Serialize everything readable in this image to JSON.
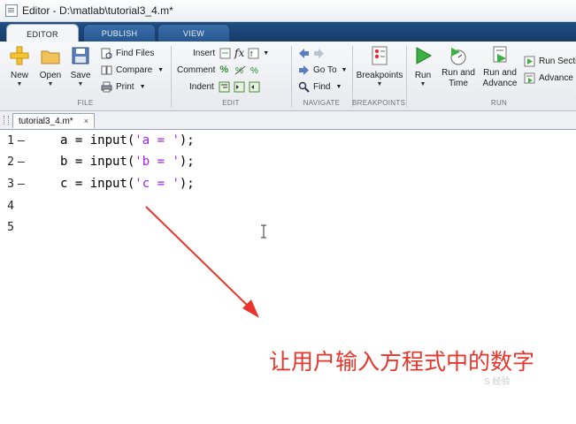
{
  "window": {
    "title": "Editor - D:\\matlab\\tutorial3_4.m*"
  },
  "ribbon": {
    "tabs": [
      {
        "label": "EDITOR"
      },
      {
        "label": "PUBLISH"
      },
      {
        "label": "VIEW"
      }
    ],
    "file": {
      "new": "New",
      "open": "Open",
      "save": "Save",
      "find_files": "Find Files",
      "compare": "Compare",
      "print": "Print",
      "group_label": "FILE"
    },
    "edit": {
      "insert": "Insert",
      "comment": "Comment",
      "indent": "Indent",
      "fx": "fx",
      "group_label": "EDIT"
    },
    "navigate": {
      "go_to": "Go To",
      "find": "Find",
      "group_label": "NAVIGATE"
    },
    "breakpoints": {
      "label": "Breakpoints",
      "group_label": "BREAKPOINTS"
    },
    "run": {
      "run": "Run",
      "run_and_time_1": "Run and",
      "run_and_time_2": "Time",
      "run_and_advance_1": "Run and",
      "run_and_advance_2": "Advance",
      "run_section": "Run Secti",
      "advance": "Advance",
      "group_label": "RUN"
    }
  },
  "document": {
    "tab_label": "tutorial3_4.m*",
    "close_glyph": "×"
  },
  "editor": {
    "lines": [
      {
        "number": "1",
        "marker": "—",
        "pre": "a = input(",
        "str": "'a = '",
        "post": ");"
      },
      {
        "number": "2",
        "marker": "—",
        "pre": "b = input(",
        "str": "'b = '",
        "post": ");"
      },
      {
        "number": "3",
        "marker": "—",
        "pre": "c = input(",
        "str": "'c = '",
        "post": ");"
      },
      {
        "number": "4",
        "marker": "",
        "pre": "",
        "str": "",
        "post": ""
      },
      {
        "number": "5",
        "marker": "",
        "pre": "",
        "str": "",
        "post": ""
      }
    ]
  },
  "annotation": {
    "text": "让用户输入方程式中的数字",
    "color": "#e8352b"
  },
  "watermark": {
    "text": "S 经验"
  }
}
